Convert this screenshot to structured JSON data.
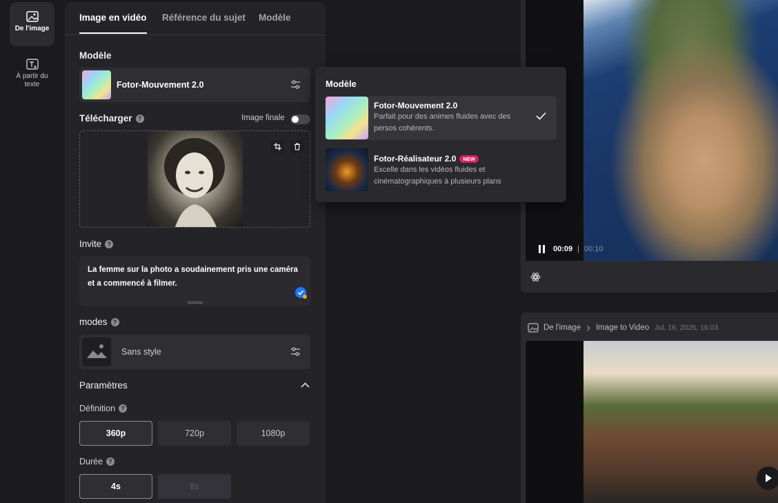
{
  "rail": {
    "items": [
      {
        "label": "De l'image",
        "icon": "image-icon"
      },
      {
        "label": "À partir du texte",
        "icon": "text-image-icon"
      }
    ]
  },
  "tabs": [
    "Image en vidéo",
    "Référence du sujet",
    "Modèle"
  ],
  "model_section": {
    "title": "Modèle",
    "selected_model": "Fotor-Mouvement 2.0"
  },
  "upload_section": {
    "title": "Télécharger",
    "final_image_label": "Image finale"
  },
  "prompt_section": {
    "title": "Invite",
    "text": "La femme sur la photo a soudainement pris une caméra et a commencé à filmer."
  },
  "modes_section": {
    "title": "modes",
    "value": "Sans style"
  },
  "params_section": {
    "title": "Paramètres",
    "definition_title": "Définition",
    "definitions": [
      "360p",
      "720p",
      "1080p"
    ],
    "definition_selected": "360p",
    "duration_title": "Durée",
    "durations": [
      "4s",
      "8s"
    ],
    "duration_selected": "4s"
  },
  "dropdown": {
    "title": "Modèle",
    "options": [
      {
        "name": "Fotor-Mouvement 2.0",
        "desc": "Parfait pour des animes fluides avec des persos cohérents.",
        "selected": true
      },
      {
        "name": "Fotor-Réalisateur 2.0",
        "badge": "NEW",
        "desc": "Excelle dans les vidéos fluides et cinématographiques à plusieurs plans",
        "selected": false
      }
    ]
  },
  "video1": {
    "current_time": "00:09",
    "total_time": "00:10"
  },
  "history": {
    "crumb_root": "De l'image",
    "crumb_leaf": "Image to Video",
    "date": "Jul, 16, 2025, 16:03"
  },
  "colors": {
    "accent_check": "#1d7af3",
    "new_badge": "#d4245d"
  }
}
